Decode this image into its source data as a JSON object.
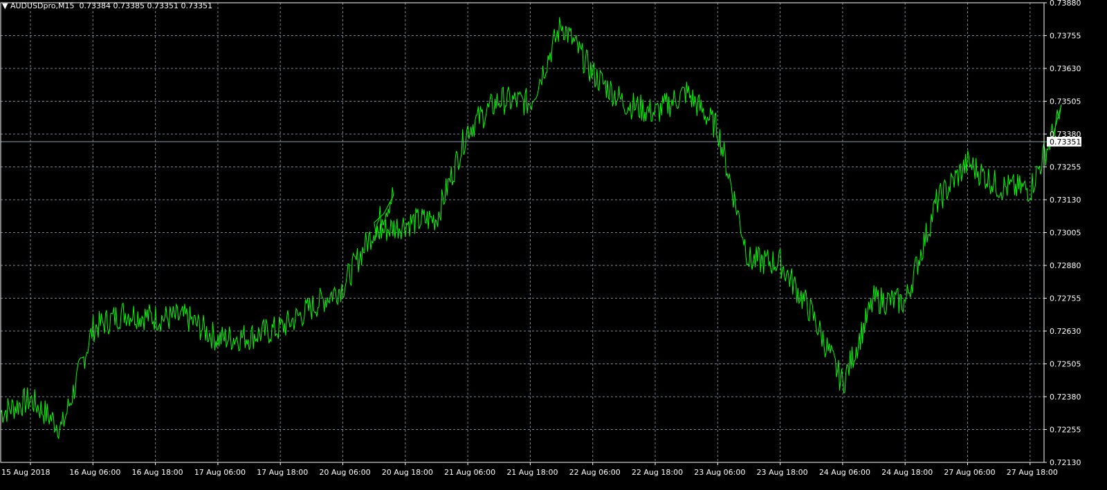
{
  "header": {
    "arrow": "▼",
    "symbol": "AUDUSDpro,M15",
    "open": "0.73384",
    "high": "0.73385",
    "low": "0.73351",
    "close": "0.73351"
  },
  "current_price": "0.73351",
  "colors": {
    "background": "#000000",
    "grid": "#7b8592",
    "frame": "#ffffff",
    "series": "#00ff00",
    "price_line": "#8fa0b3",
    "price_label_bg": "#ffffff",
    "price_label_fg": "#000000"
  },
  "chart_data": {
    "type": "line",
    "y_ticks": [
      "0.73880",
      "0.73755",
      "0.73630",
      "0.73505",
      "0.73380",
      "0.73255",
      "0.73130",
      "0.73005",
      "0.72880",
      "0.72755",
      "0.72630",
      "0.72505",
      "0.72380",
      "0.72255",
      "0.72130"
    ],
    "x_ticks": [
      "15 Aug 2018",
      "16 Aug 06:00",
      "16 Aug 18:00",
      "17 Aug 06:00",
      "17 Aug 18:00",
      "20 Aug 06:00",
      "20 Aug 18:00",
      "21 Aug 06:00",
      "21 Aug 18:00",
      "22 Aug 06:00",
      "22 Aug 18:00",
      "23 Aug 06:00",
      "23 Aug 18:00",
      "24 Aug 06:00",
      "24 Aug 18:00",
      "27 Aug 06:00",
      "27 Aug 18:00"
    ],
    "ylim": [
      0.7213,
      0.7388
    ],
    "grid": true,
    "series": [
      {
        "x": [
          "15 Aug 2018",
          "15 Aug 06:00",
          "15 Aug 12:00",
          "15 Aug 18:00",
          "16 Aug 00:00",
          "16 Aug 06:00",
          "16 Aug 12:00",
          "16 Aug 18:00",
          "17 Aug 00:00",
          "17 Aug 06:00",
          "17 Aug 12:00",
          "17 Aug 18:00",
          "18 Aug 00:00",
          "20 Aug 00:00",
          "20 Aug 06:00",
          "20 Aug 12:00",
          "20 Aug 18:00",
          "21 Aug 00:00",
          "21 Aug 06:00",
          "21 Aug 12:00",
          "21 Aug 18:00",
          "22 Aug 00:00",
          "22 Aug 06:00",
          "22 Aug 12:00",
          "22 Aug 18:00",
          "23 Aug 00:00",
          "23 Aug 06:00",
          "23 Aug 12:00",
          "23 Aug 18:00",
          "24 Aug 00:00",
          "24 Aug 06:00",
          "24 Aug 12:00",
          "24 Aug 18:00",
          "27 Aug 00:00",
          "27 Aug 06:00",
          "27 Aug 12:00",
          "27 Aug 18:00"
        ],
        "y": [
          0.7232,
          0.7237,
          0.7226,
          0.7264,
          0.727,
          0.7268,
          0.7268,
          0.726,
          0.7261,
          0.7264,
          0.7272,
          0.728,
          0.7315,
          0.73,
          0.7304,
          0.7306,
          0.734,
          0.7351,
          0.735,
          0.738,
          0.7361,
          0.735,
          0.7346,
          0.7354,
          0.734,
          0.729,
          0.7289,
          0.727,
          0.7243,
          0.7275,
          0.7274,
          0.7312,
          0.7327,
          0.7318,
          0.7317,
          0.7346,
          0.7335
        ]
      }
    ]
  }
}
